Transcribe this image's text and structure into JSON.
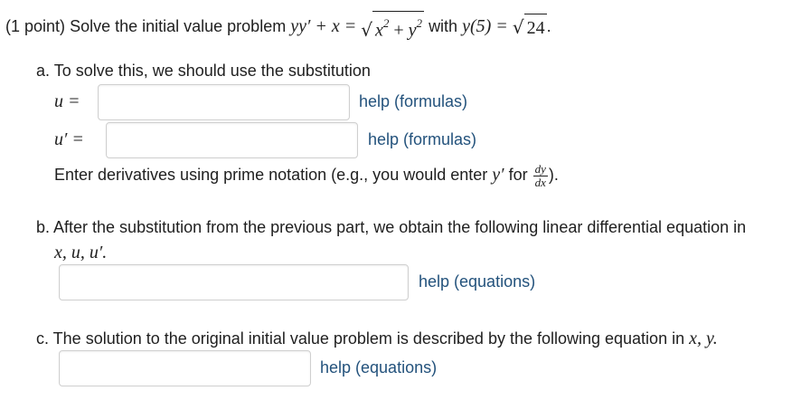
{
  "problem": {
    "points": "(1 point)",
    "intro": "Solve the initial value problem",
    "equation_lhs": "yy′ + x =",
    "radicand_x": "x",
    "radicand_y": "y",
    "exponent": "2",
    "plus": " + ",
    "with_label": "with",
    "initial_lhs": "y(5) =",
    "initial_value": "24",
    "period": "."
  },
  "part_a": {
    "prompt": "a. To solve this, we should use the substitution",
    "u_label": "u =",
    "u_prime_label": "u′ =",
    "u_value": "",
    "u_prime_value": "",
    "help1": "help (formulas)",
    "help2": "help (formulas)",
    "note_pre": "Enter derivatives using prime notation (e.g., you would enter",
    "note_y_prime": "y′",
    "note_for": "for",
    "dy": "dy",
    "dx": "dx",
    "note_close": ")."
  },
  "part_b": {
    "prompt": "b. After the substitution from the previous part, we obtain the following linear differential equation in",
    "vars": "x, u, u′.",
    "value": "",
    "help": "help (equations)"
  },
  "part_c": {
    "prompt": "c. The solution to the original initial value problem is described by the following equation in",
    "vars": "x, y.",
    "value": "",
    "help": "help (equations)"
  },
  "colors": {
    "text": "#1f1f1f",
    "link": "#23527c",
    "input_border": "#cfcfcf"
  }
}
